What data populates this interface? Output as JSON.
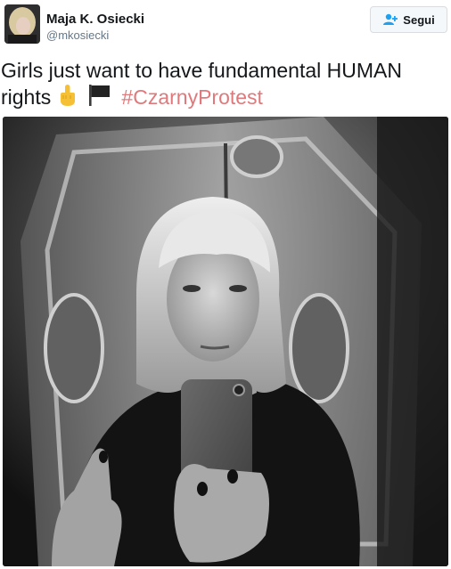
{
  "author": {
    "name": "Maja K. Osiecki",
    "handle": "@mkosiecki"
  },
  "follow_button": {
    "label": "Segui",
    "icon": "add-user-icon"
  },
  "tweet": {
    "text_before": "Girls just want to have fundamental HUMAN rights",
    "emojis": [
      "middle-finger-emoji",
      "black-flag-emoji"
    ],
    "hashtag": "#CzarnyProtest"
  },
  "colors": {
    "hashtag": "#e0797b",
    "handle": "#657786",
    "follow_icon": "#1da1f2"
  },
  "media": {
    "description_icon": "photo"
  }
}
